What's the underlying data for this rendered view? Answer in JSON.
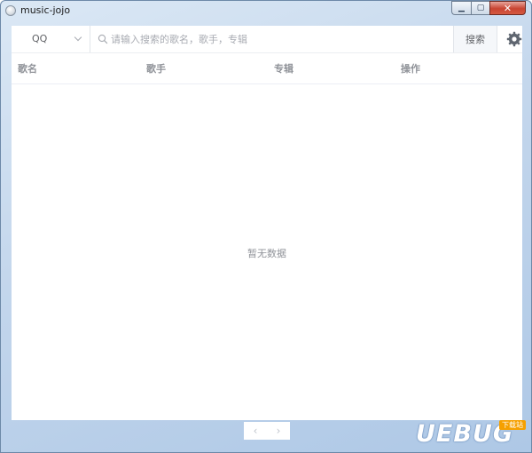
{
  "window": {
    "title": "music-jojo",
    "controls": {
      "minimize": "▁",
      "maximize": "▢",
      "close": "✕"
    }
  },
  "search": {
    "source_value": "QQ",
    "placeholder": "请输入搜索的歌名，歌手，专辑",
    "button_label": "搜索"
  },
  "table": {
    "columns": [
      "歌名",
      "歌手",
      "专辑",
      "操作"
    ],
    "rows": [],
    "empty_text": "暂无数据"
  },
  "pagination": {
    "prev": "‹",
    "next": "›"
  },
  "watermark": {
    "text": "UEBUG",
    "badge": "下载站"
  },
  "colors": {
    "accent": "#409eff",
    "muted_text": "#909399",
    "window_bg": "#c3d6ec"
  }
}
